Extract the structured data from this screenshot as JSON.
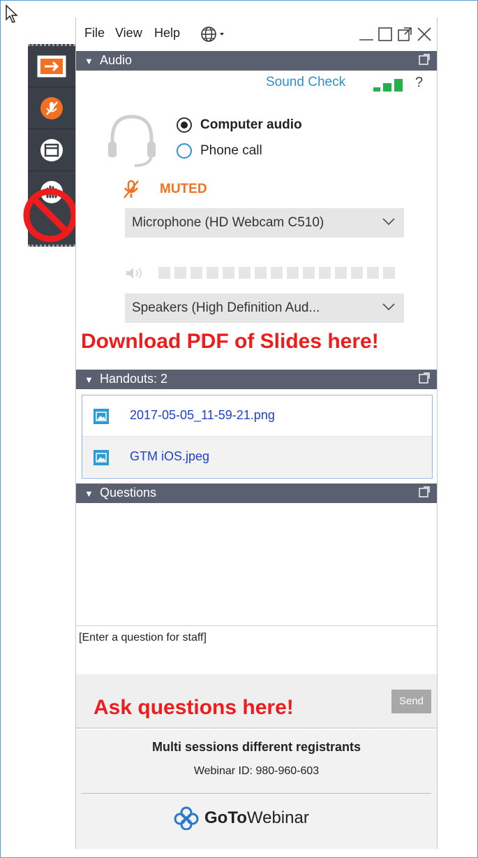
{
  "menu": {
    "file": "File",
    "view": "View",
    "help": "Help",
    "globe_icon": "globe-icon"
  },
  "window_controls": [
    "minimize-icon",
    "maximize-icon",
    "popout-icon",
    "close-icon"
  ],
  "audio": {
    "section_title": "Audio",
    "sound_check": "Sound Check",
    "help_mark": "?",
    "options": [
      "Computer audio",
      "Phone call"
    ],
    "selected_option": "Computer audio",
    "mute_status": "MUTED",
    "microphone": "Microphone (HD Webcam C510)",
    "speakers": "Speakers (High Definition Aud..."
  },
  "annotations": {
    "download": "Download PDF of Slides here!",
    "ask": "Ask questions here!"
  },
  "handouts": {
    "section_title": "Handouts: 2",
    "files": [
      "2017-05-05_11-59-21.png",
      "GTM iOS.jpeg"
    ]
  },
  "questions": {
    "section_title": "Questions",
    "placeholder": "[Enter a question for staff]",
    "send_label": "Send"
  },
  "footer": {
    "session_title": "Multi sessions different registrants",
    "webinar_id": "Webinar ID: 980-960-603",
    "brand_bold": "GoTo",
    "brand_rest": "Webinar"
  },
  "colors": {
    "accent_orange": "#f37021",
    "link_blue": "#2e8fcf",
    "section_bar": "#5a6070",
    "annotation_red": "#ee1c1c"
  }
}
